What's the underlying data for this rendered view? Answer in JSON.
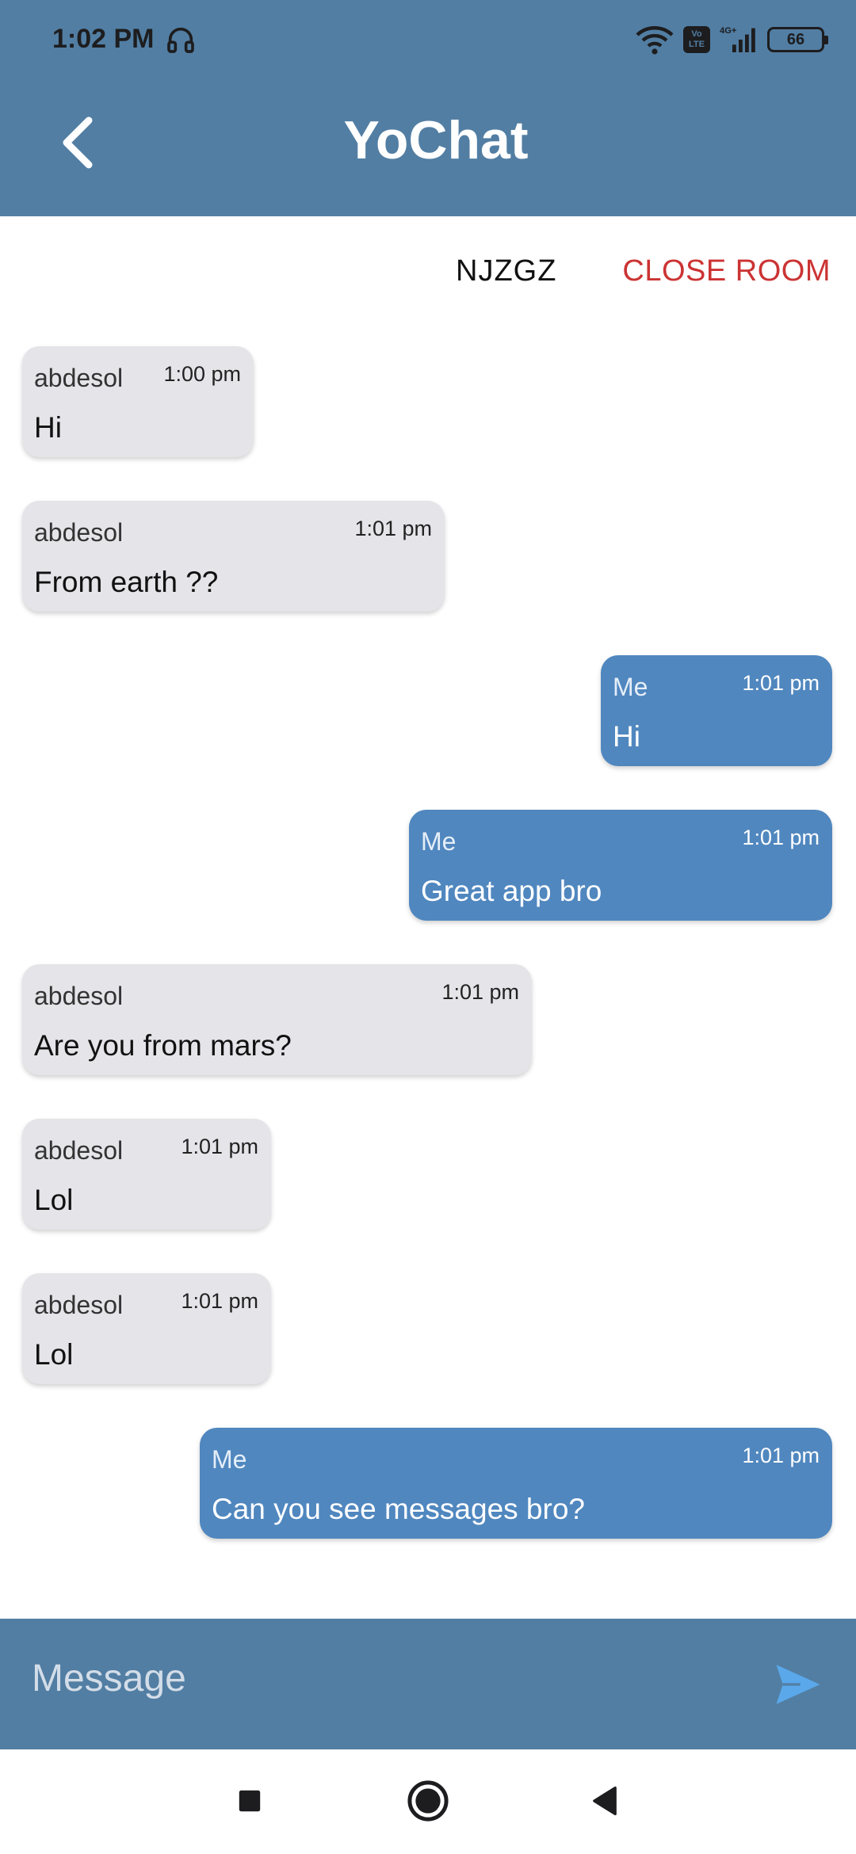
{
  "status_bar": {
    "time": "1:02 PM",
    "network": "4G+",
    "volte": "Vo LTE",
    "battery": "66"
  },
  "app_bar": {
    "title": "YoChat"
  },
  "room": {
    "code": "NJZGZ",
    "close_label": "CLOSE ROOM"
  },
  "messages": [
    {
      "sender": "abdesol",
      "time": "1:00 pm",
      "text": "Hi",
      "outgoing": false
    },
    {
      "sender": "abdesol",
      "time": "1:01 pm",
      "text": "From earth ??",
      "outgoing": false
    },
    {
      "sender": "Me",
      "time": "1:01 pm",
      "text": "Hi",
      "outgoing": true
    },
    {
      "sender": "Me",
      "time": "1:01 pm",
      "text": "Great app bro",
      "outgoing": true
    },
    {
      "sender": "abdesol",
      "time": "1:01 pm",
      "text": "Are you from mars?",
      "outgoing": false
    },
    {
      "sender": "abdesol",
      "time": "1:01 pm",
      "text": "Lol",
      "outgoing": false
    },
    {
      "sender": "abdesol",
      "time": "1:01 pm",
      "text": "Lol",
      "outgoing": false
    },
    {
      "sender": "Me",
      "time": "1:01 pm",
      "text": "Can you see messages bro?",
      "outgoing": true
    }
  ],
  "composer": {
    "placeholder": "Message",
    "value": ""
  },
  "colors": {
    "app_bar": "#527ea3",
    "incoming_bubble": "#e4e4e9",
    "outgoing_bubble": "#5087bf",
    "close_room": "#cc3333",
    "send_icon": "#5aa8ea"
  },
  "icons": {
    "back": "chevron-left-icon",
    "send": "send-icon",
    "nav_recents": "square-icon",
    "nav_home": "circle-icon",
    "nav_back": "triangle-back-icon"
  }
}
